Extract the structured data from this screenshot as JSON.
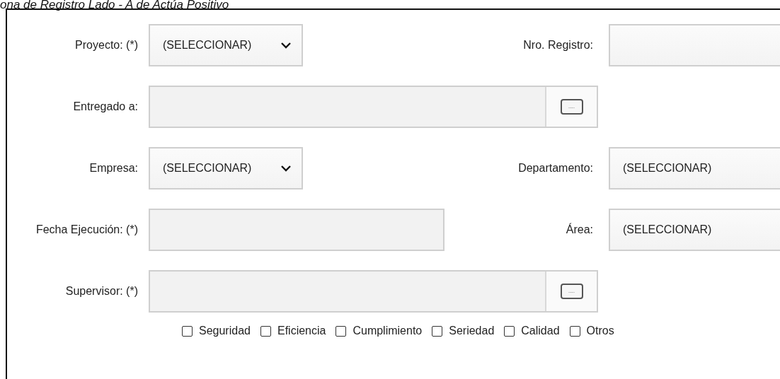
{
  "caption": "ona de Registro Lado - A de Actúa Positivo",
  "rows": [
    {
      "left": {
        "label": "Proyecto: (*)",
        "kind": "select",
        "value": "(SELECCIONAR)"
      },
      "right": {
        "label": "Nro. Registro:",
        "kind": "text"
      }
    },
    {
      "left": {
        "label": "Entregado a:",
        "kind": "lookup",
        "button_label": "...."
      }
    },
    {
      "left": {
        "label": "Empresa:",
        "kind": "select",
        "value": "(SELECCIONAR)"
      },
      "right": {
        "label": "Departamento:",
        "kind": "select",
        "value": "(SELECCIONAR)"
      }
    },
    {
      "left": {
        "label": "Fecha Ejecución: (*)",
        "kind": "text"
      },
      "right": {
        "label": "Área:",
        "kind": "select",
        "value": "(SELECCIONAR)"
      }
    },
    {
      "left": {
        "label": "Supervisor: (*)",
        "kind": "lookup",
        "button_label": "...."
      }
    }
  ],
  "checkboxes": [
    {
      "label": "Seguridad",
      "checked": false
    },
    {
      "label": "Eficiencia",
      "checked": false
    },
    {
      "label": "Cumplimiento",
      "checked": false
    },
    {
      "label": "Seriedad",
      "checked": false
    },
    {
      "label": "Calidad",
      "checked": false
    },
    {
      "label": "Otros",
      "checked": false
    }
  ]
}
